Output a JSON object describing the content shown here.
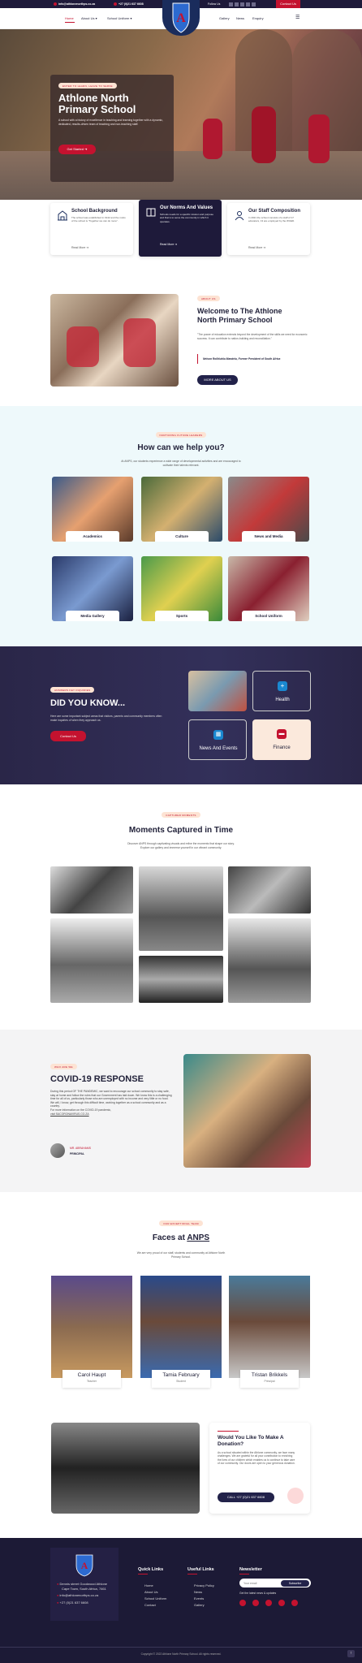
{
  "topbar": {
    "email": "info@athlonenorthps.co.za",
    "phone": "+27 (0)21 637 6608",
    "follow": "Follow Us",
    "contact": "Contact Us"
  },
  "nav": {
    "home": "Home",
    "about": "About Us",
    "uniform": "School Uniform",
    "gallery": "Gallery",
    "news": "News",
    "enquiry": "Enquiry"
  },
  "hero": {
    "pill": "ENTER TO LEARN, LEAVE TO SERVE",
    "title1": "Athlone North",
    "title2": "Primary School",
    "desc": "A school with a history of excellence in teaching and learning together with a dynamic, dedicated, results-driven team of teaching and non-teaching staff.",
    "button": "Get Started"
  },
  "features": [
    {
      "title": "School Background",
      "text": "The school was established in 1942 and the motto of the school is \"Together we can do more\".",
      "more": "Read More"
    },
    {
      "title": "Our Norms And Values",
      "text": "Schools needs for a specific mission and purpose and that is to serve the community in which it operates.",
      "more": "Read More"
    },
    {
      "title": "Our Staff Composition",
      "text": "In 2021 the school consists of a staff of 17 educators, 13 are employed by the WCED.",
      "more": "Read More"
    }
  ],
  "welcome": {
    "pill": "ABOUT US",
    "title1": "Welcome to The Athlone",
    "title2": "North Primary School",
    "quote": "\"The power of education extends beyond the development of the skills we need for economic success. It can contribute to nation-building and reconciliation.\"",
    "author": "Nelson Rolihlahla Mandela, Former President of South Africa",
    "button": "MORE ABOUT US"
  },
  "services": {
    "pill": "NURTURING FUTURE LEADERS",
    "title": "How can we help you?",
    "desc1": "At ANPS, our students experience a wide range of developmental activities and are encouraged to",
    "desc2": "cultivate their talents relevant.",
    "items": [
      "Academics",
      "Culture",
      "News and Media",
      "Media Gallery",
      "Sports",
      "School Uniform"
    ]
  },
  "dyk": {
    "pill": "ANSWERS KEY INQUIRIES",
    "title": "DID YOU KNOW...",
    "desc": "Here are some important subject areas that visitors, parents and community members often make inquiries of when they approach us.",
    "button": "Contact Us",
    "boxes": [
      "Health",
      "News And Events",
      "Finance"
    ]
  },
  "moments": {
    "pill": "CAPTURED MOMENTS",
    "title": "Moments Captured in Time",
    "desc1": "Discover ANPS through captivating visuals and relive the moments that shape our story.",
    "desc2": "Explore our gallery and immerse yourself in our vibrant community."
  },
  "covid": {
    "pill": "WHO ARE WE",
    "title": "COVID-19 RESPONSE",
    "p1": "During this period OF THE PANDEMIC, we want to encourage our school community to stay safe, stay at home and follow the rules that our Government has laid down. We know this is a challenging time for all of us, particularly those who are unemployed with no income and very little or no food.",
    "p2": "We will, I know, get through this difficult time, working together as a school community and as a country.",
    "p3": "For more information on the COVID-19 pandemic,",
    "p4": "visit SACORONAVIRUS.CO.ZA",
    "sign_name": "MR. ABRAHAMS",
    "sign_role": "PRINCIPAL"
  },
  "faces": {
    "pill": "OUR EXCEPTIONAL TEAM",
    "title_a": "Faces at ",
    "title_b": "ANPS",
    "desc1": "We are very proud of our staff, students and community at Athlone North",
    "desc2": "Primary School.",
    "people": [
      {
        "name": "Carol Haupt",
        "role": "Teacher"
      },
      {
        "name": "Tamia February",
        "role": "Student"
      },
      {
        "name": "Tristan Brikkels",
        "role": "Principal"
      }
    ]
  },
  "donate": {
    "title1": "Would You Like To Make A",
    "title2": "Donation?",
    "text": "As a school situated within the Athlone community, we face many challenges. We are grateful for all your contribution to enriching the lives of our children which enables us to continue to take care of our community. Our doors are open to your generous donation.",
    "button": "CALL +27 (0)21 637 6608"
  },
  "footer": {
    "addr1": "Dennis street Goodwood Athlone",
    "addr2": "Cape Town, South Africa, 7461",
    "email": "info@athlonenorthps.co.za",
    "phone": "+27 (0)21 637 6608",
    "quick": "Quick Links",
    "quick_items": [
      "Home",
      "About Us",
      "School Uniform",
      "Contact"
    ],
    "useful": "Useful Links",
    "useful_items": [
      "Privacy Policy",
      "News",
      "Events",
      "Gallery"
    ],
    "news": "Newsletter",
    "news_ph": "Your email",
    "subscribe": "Subscribe",
    "news_note": "Get the latest news & updates",
    "copyright": "Copyright © 2022 Athlone North Primary School. All rights reserved."
  },
  "colors": {
    "accent": "#c4122f",
    "navy": "#22224a",
    "footer": "#1c1a36"
  }
}
